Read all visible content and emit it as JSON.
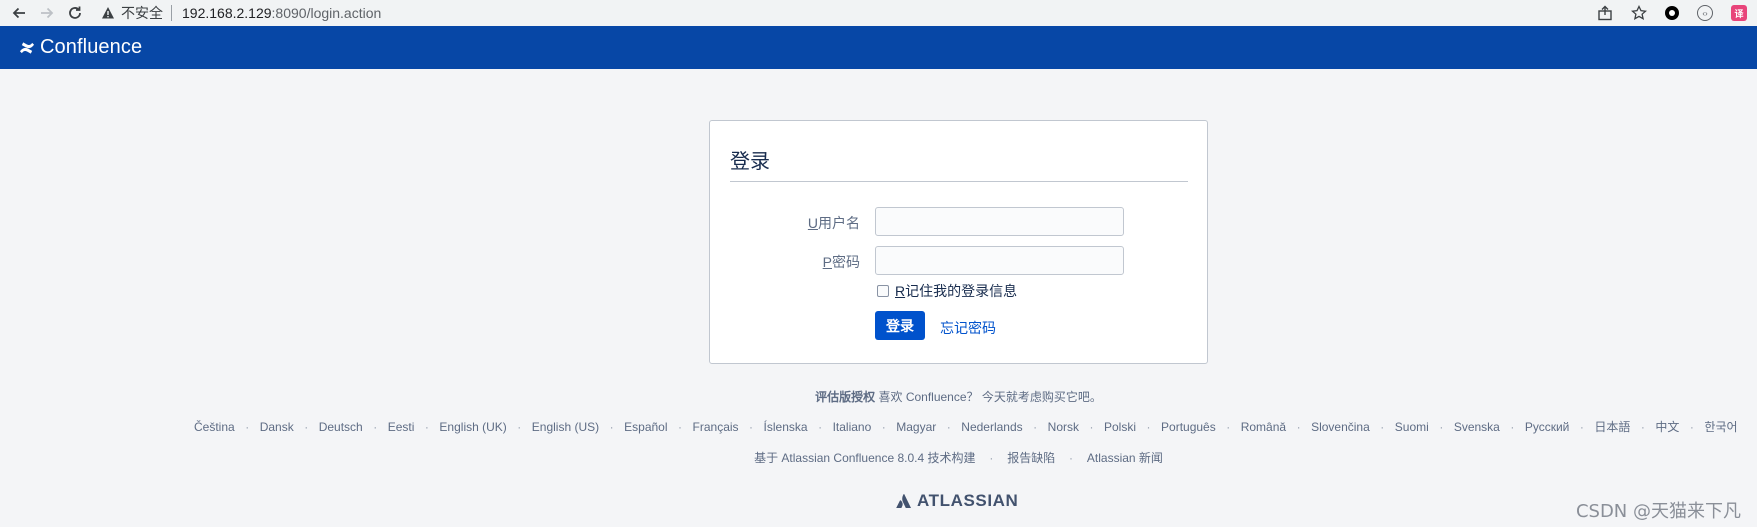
{
  "browser": {
    "security_label": "不安全",
    "url_host": "192.168.2.129",
    "url_rest": ":8090/login.action"
  },
  "header": {
    "app_name": "Confluence",
    "brand_color": "#0747a6"
  },
  "login": {
    "title": "登录",
    "username_accesskey": "U",
    "username_label": "用户名",
    "username_value": "",
    "password_accesskey": "P",
    "password_label": "密码",
    "password_value": "",
    "remember_accesskey": "R",
    "remember_label": "记住我的登录信息",
    "remember_checked": false,
    "submit_label": "登录",
    "forgot_label": "忘记密码",
    "button_color": "#0052cc"
  },
  "footer": {
    "license_strong": "评估版授权",
    "license_text": "喜欢 Confluence？ 今天就考虑购买它吧。",
    "languages": [
      "Čeština",
      "Dansk",
      "Deutsch",
      "Eesti",
      "English (UK)",
      "English (US)",
      "Español",
      "Français",
      "Íslenska",
      "Italiano",
      "Magyar",
      "Nederlands",
      "Norsk",
      "Polski",
      "Português",
      "Română",
      "Slovenčina",
      "Suomi",
      "Svenska",
      "Русский",
      "日本語",
      "中文",
      "한국어"
    ],
    "build_text": "基于 Atlassian Confluence 8.0.4 技术构建",
    "report_bug": "报告缺陷",
    "atlassian_news": "Atlassian 新闻",
    "atlassian_brand": "ATLASSIAN"
  },
  "watermark": "CSDN @天猫来下凡"
}
